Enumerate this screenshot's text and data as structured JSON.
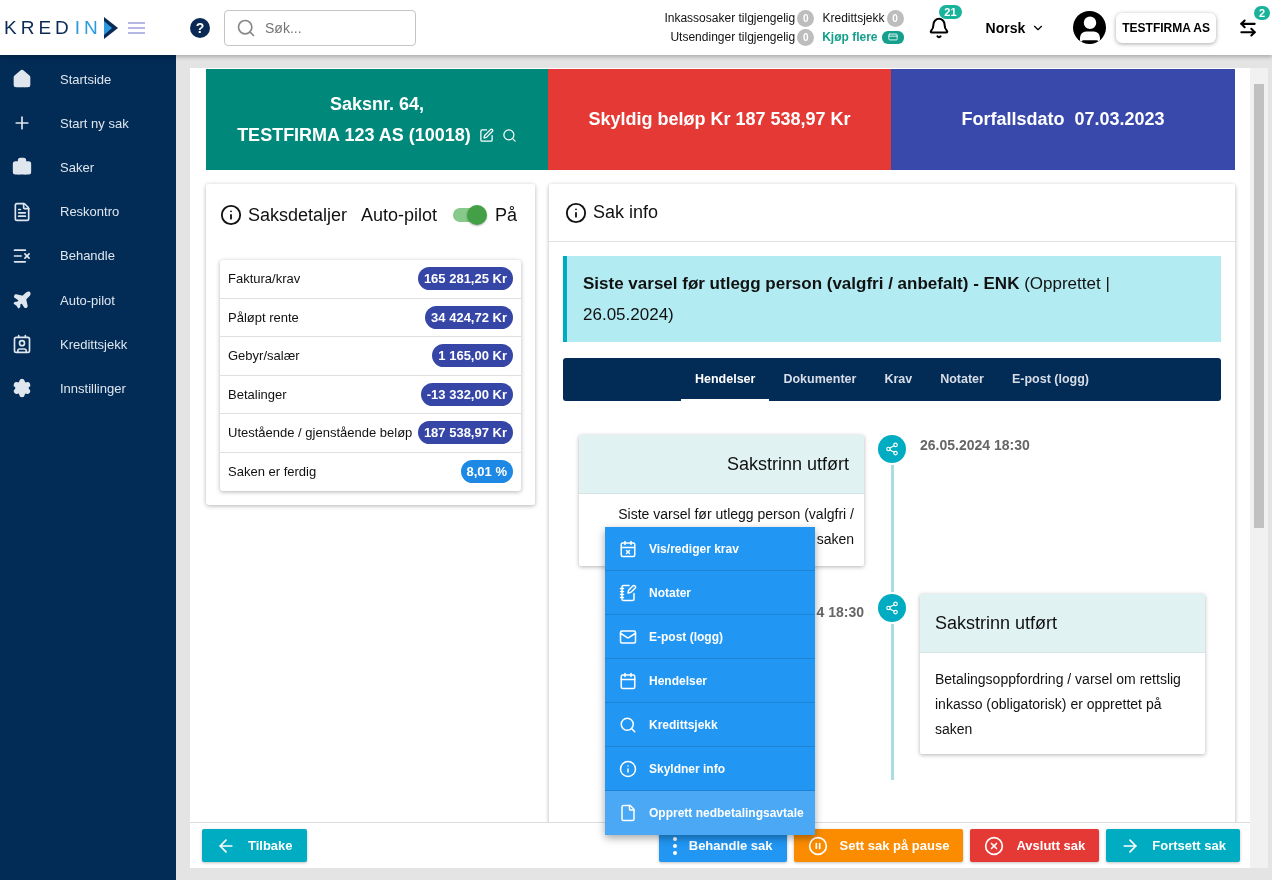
{
  "header": {
    "help": "?",
    "logo": {
      "part_1": "KRED",
      "part_2": "IN"
    },
    "search": {
      "placeholder": "Søk..."
    },
    "counters": [
      {
        "label": "Inkassosaker tilgjengelig",
        "count": "0"
      },
      {
        "label": "Kredittsjekk",
        "count": "0"
      },
      {
        "label": "Utsendinger tilgjengelig",
        "count": "0"
      }
    ],
    "buy_more": "Kjøp flere",
    "notifications": "21",
    "language": "Norsk",
    "company": "TESTFIRMA AS",
    "switch_count": "2"
  },
  "sidebar": {
    "items": [
      {
        "label": "Startside"
      },
      {
        "label": "Start ny sak"
      },
      {
        "label": "Saker"
      },
      {
        "label": "Reskontro"
      },
      {
        "label": "Behandle"
      },
      {
        "label": "Auto-pilot"
      },
      {
        "label": "Kredittsjekk"
      },
      {
        "label": "Innstillinger"
      }
    ]
  },
  "banner": {
    "case_line_1": "Saksnr. 64,",
    "case_line_2": "TESTFIRMA 123 AS (10018)",
    "amount": "Skyldig beløp Kr 187 538,97 Kr",
    "due": "Forfallsdato  07.03.2023"
  },
  "details": {
    "title": "Saksdetaljer",
    "autopilot_label": "Auto-pilot",
    "autopilot_on": true,
    "autopilot_state": "På",
    "rows": [
      {
        "label": "Faktura/krav",
        "value": "165 281,25 Kr",
        "kind": "amount"
      },
      {
        "label": "Påløpt rente",
        "value": "34 424,72 Kr",
        "kind": "amount"
      },
      {
        "label": "Gebyr/salær",
        "value": "1 165,00 Kr",
        "kind": "amount"
      },
      {
        "label": "Betalinger",
        "value": "-13 332,00 Kr",
        "kind": "amount"
      },
      {
        "label": "Utestående / gjenstående beløp",
        "value": "187 538,97 Kr",
        "kind": "amount"
      },
      {
        "label": "Saken er ferdig",
        "value": "8,01 %",
        "kind": "percent"
      }
    ]
  },
  "info": {
    "title": "Sak info",
    "notice": "**Siste varsel før utlegg person (valgfri / anbefalt) - ENK** (Opprettet | 26.05.2024)",
    "tabs": [
      {
        "label": "Hendelser",
        "selected": true
      },
      {
        "label": "Dokumenter",
        "selected": false
      },
      {
        "label": "Krav",
        "selected": false
      },
      {
        "label": "Notater",
        "selected": false
      },
      {
        "label": "E-post (logg)",
        "selected": false
      }
    ],
    "timeline": [
      {
        "date": "26.05.2024 18:30",
        "title": "Sakstrinn utført",
        "text_lines": [
          "Siste varsel før utlegg person (valgfri /",
          "saken"
        ]
      },
      {
        "date": "4 18:30",
        "title": "Sakstrinn utført",
        "text_lines": [
          "Betalingsoppfordring / varsel om rettslig inkasso (obligatorisk) er opprettet på saken"
        ]
      }
    ]
  },
  "menu": [
    {
      "label": "Vis/rediger krav",
      "highlighted": false
    },
    {
      "label": "Notater",
      "highlighted": false
    },
    {
      "label": "E-post (logg)",
      "highlighted": false
    },
    {
      "label": "Hendelser",
      "highlighted": false
    },
    {
      "label": "Kredittsjekk",
      "highlighted": false
    },
    {
      "label": "Skyldner info",
      "highlighted": false
    },
    {
      "label": "Opprett nedbetalingsavtale",
      "highlighted": true
    }
  ],
  "footer": {
    "back": "Tilbake",
    "actions": [
      {
        "label": "Behandle sak",
        "kind": "handle"
      },
      {
        "label": "Sett sak på pause",
        "kind": "pause"
      },
      {
        "label": "Avslutt sak",
        "kind": "end"
      },
      {
        "label": "Fortsett sak",
        "kind": "continue"
      }
    ]
  }
}
